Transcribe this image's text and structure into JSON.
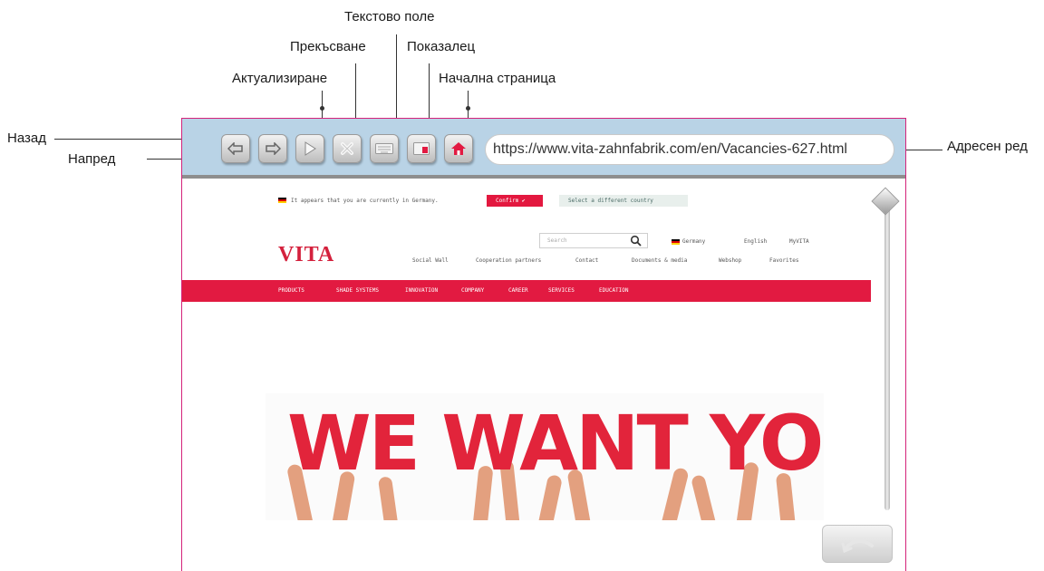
{
  "annotations": {
    "back": "Назад",
    "forward": "Напред",
    "refresh": "Актуализиране",
    "stop": "Прекъсване",
    "text_field": "Текстово поле",
    "pointer": "Показалец",
    "home": "Начална страница",
    "address_bar": "Адресен ред"
  },
  "browser": {
    "url": "https://www.vita-zahnfabrik.com/en/Vacancies-627.html",
    "toolbar_icons": [
      "back-arrow-icon",
      "forward-arrow-icon",
      "play-icon",
      "close-x-icon",
      "keyboard-icon",
      "pointer-icon",
      "home-icon"
    ],
    "colors": {
      "toolbar": "#b9d3e6",
      "frame_border": "#d4237a"
    }
  },
  "page": {
    "notice": "It appears that you are currently in Germany.",
    "confirm": "Confirm ✔",
    "select_country": "Select a different country",
    "logo": "VITA",
    "search_placeholder": "Search",
    "country": "Germany",
    "language": "English",
    "account": "MyVITA",
    "subnav": [
      "Social Wall",
      "Cooperation partners",
      "Contact",
      "Documents & media",
      "Webshop",
      "Favorites"
    ],
    "mainnav": [
      "PRODUCTS",
      "SHADE SYSTEMS",
      "INNOVATION",
      "COMPANY",
      "CAREER",
      "SERVICES",
      "EDUCATION"
    ],
    "hero_text": "WE WANT YOU",
    "colors": {
      "brand_red": "#e21a41"
    }
  }
}
